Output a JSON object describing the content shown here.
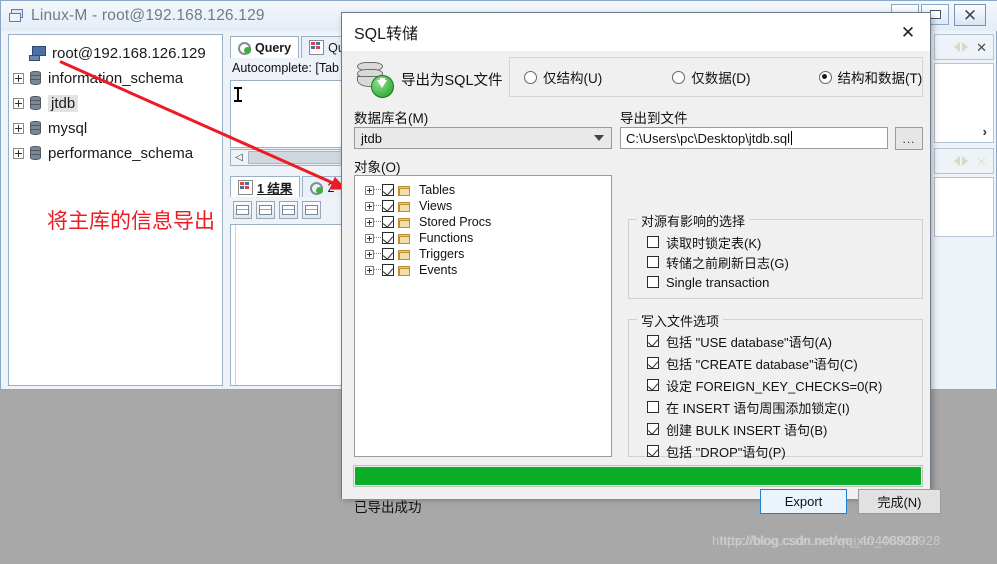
{
  "window": {
    "title": "Linux-M - root@192.168.126.129",
    "icon": "window-restore-icon",
    "minimize_label": "",
    "maximize_label": "",
    "close_label": "✕"
  },
  "tree": {
    "root": "root@192.168.126.129",
    "items": [
      {
        "label": "information_schema",
        "selected": false
      },
      {
        "label": "jtdb",
        "selected": true
      },
      {
        "label": "mysql",
        "selected": false
      },
      {
        "label": "performance_schema",
        "selected": false
      }
    ]
  },
  "editor": {
    "tabs": [
      {
        "label": "Query",
        "active": true,
        "icon": "query-icon"
      },
      {
        "label": "Que",
        "active": false,
        "icon": "grid-icon"
      }
    ],
    "autocomplete": "Autocomplete: [Tab",
    "result_tab": "1 结果",
    "result_tab_number": "1",
    "result_tab_extra": "2"
  },
  "annotation": {
    "text": "将主库的信息导出",
    "color": "#ee1b24"
  },
  "dialog": {
    "title": "SQL转储",
    "close_label": "✕",
    "icon": "database-export-icon",
    "mode_label": "导出为SQL文件",
    "modes": [
      {
        "label": "仅结构(U)",
        "checked": false
      },
      {
        "label": "仅数据(D)",
        "checked": false
      },
      {
        "label": "结构和数据(T)",
        "checked": true
      }
    ],
    "db_label": "数据库名(M)",
    "db_value": "jtdb",
    "file_label": "导出到文件",
    "file_value": "C:\\Users\\pc\\Desktop\\jtdb.sql",
    "browse_label": "...",
    "objects_label": "对象(O)",
    "objects": [
      {
        "label": "Tables",
        "checked": true
      },
      {
        "label": "Views",
        "checked": true
      },
      {
        "label": "Stored Procs",
        "checked": true
      },
      {
        "label": "Functions",
        "checked": true
      },
      {
        "label": "Triggers",
        "checked": true
      },
      {
        "label": "Events",
        "checked": true
      }
    ],
    "source_group_label": "对源有影响的选择",
    "source_options": [
      {
        "label": "读取时锁定表(K)",
        "checked": false
      },
      {
        "label": "转储之前刷新日志(G)",
        "checked": false
      },
      {
        "label": "Single transaction",
        "checked": false
      }
    ],
    "write_group_label": "写入文件选项",
    "write_options": [
      {
        "label": "包括 \"USE database\"语句(A)",
        "checked": true
      },
      {
        "label": "包括 \"CREATE database\"语句(C)",
        "checked": true
      },
      {
        "label": "设定 FOREIGN_KEY_CHECKS=0(R)",
        "checked": true
      },
      {
        "label": "在 INSERT 语句周围添加锁定(I)",
        "checked": false
      },
      {
        "label": "创建 BULK INSERT 语句(B)",
        "checked": true
      },
      {
        "label": "包括 \"DROP\"语句(P)",
        "checked": true
      }
    ],
    "progress_percent": "100",
    "progress_color": "#0aac28",
    "status_text": "已导出成功",
    "export_label": "Export",
    "finish_label": "完成(N)"
  },
  "watermark": {
    "line1": "https://blog.csdn.net/weixin_46808928",
    "line2": "http://blog.csdn.net/qq_40408928"
  }
}
